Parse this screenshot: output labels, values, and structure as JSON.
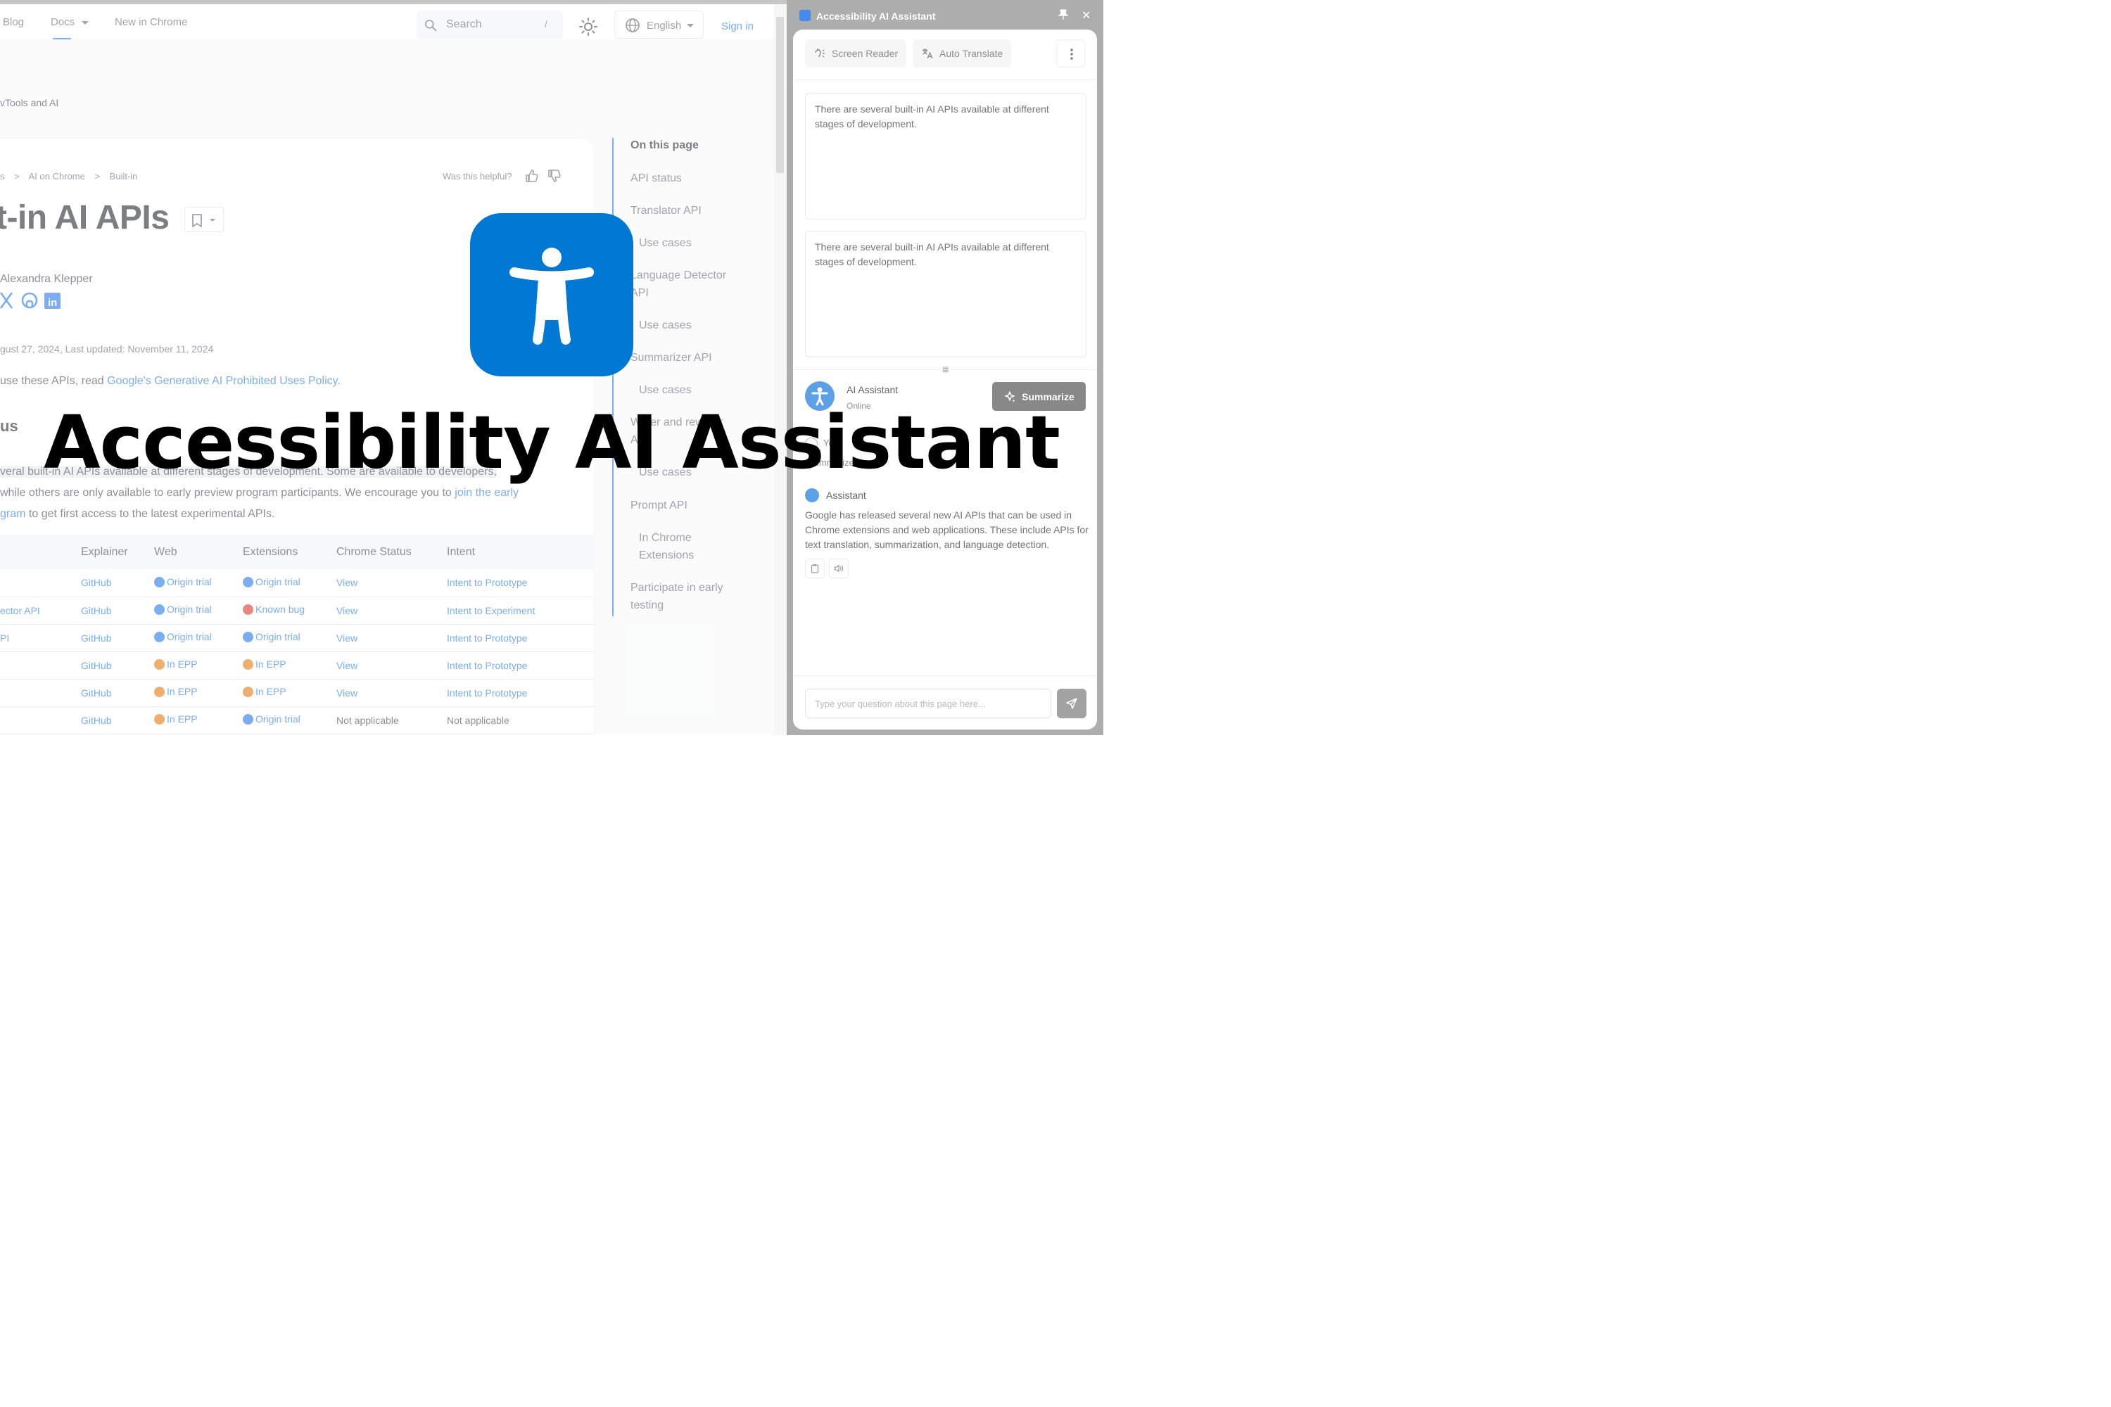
{
  "nav": {
    "items": [
      "Blog",
      "Docs",
      "New in Chrome"
    ],
    "search_placeholder": "Search",
    "search_shortcut": "/",
    "language": "English",
    "sign_in": "Sign in"
  },
  "subheader": {
    "text": "vTools and AI"
  },
  "breadcrumb": {
    "items": [
      "s",
      ">",
      "AI on Chrome",
      ">",
      "Built-in"
    ]
  },
  "feedback": {
    "label": "Was this helpful?"
  },
  "article": {
    "title": "t-in AI APIs",
    "author": "Alexandra Klepper",
    "dates": "gust 27, 2024, Last updated: November 11, 2024",
    "policy_prefix": "use these APIs, read ",
    "policy_link": "Google's Generative AI Prohibited Uses Policy",
    "policy_suffix": ".",
    "section_heading": "us",
    "para_line1": "veral built-in AI APIs available at different stages of development. Some are available to developers,",
    "para_line2_a": "while others are only available to early preview program participants. We encourage you to ",
    "para_line2_link": "join the early",
    "para_line3_link": "gram",
    "para_line3_b": " to get first access to the latest experimental APIs."
  },
  "table": {
    "headers": [
      "",
      "Explainer",
      "Web",
      "Extensions",
      "Chrome Status",
      "Intent"
    ],
    "rows": [
      {
        "api": "",
        "explainer": "GitHub",
        "web": "Origin trial",
        "web_icon": "blue",
        "ext": "Origin trial",
        "ext_icon": "blue",
        "status": "View",
        "intent": "Intent to Prototype"
      },
      {
        "api": "ector API",
        "explainer": "GitHub",
        "web": "Origin trial",
        "web_icon": "blue",
        "ext": "Known bug",
        "ext_icon": "red",
        "status": "View",
        "intent": "Intent to Experiment"
      },
      {
        "api": "PI",
        "explainer": "GitHub",
        "web": "Origin trial",
        "web_icon": "blue",
        "ext": "Origin trial",
        "ext_icon": "blue",
        "status": "View",
        "intent": "Intent to Prototype"
      },
      {
        "api": "",
        "explainer": "GitHub",
        "web": "In EPP",
        "web_icon": "orange",
        "ext": "In EPP",
        "ext_icon": "orange",
        "status": "View",
        "intent": "Intent to Prototype"
      },
      {
        "api": "",
        "explainer": "GitHub",
        "web": "In EPP",
        "web_icon": "orange",
        "ext": "In EPP",
        "ext_icon": "orange",
        "status": "View",
        "intent": "Intent to Prototype"
      },
      {
        "api": "",
        "explainer": "GitHub",
        "web": "In EPP",
        "web_icon": "orange",
        "ext": "Origin trial",
        "ext_icon": "blue",
        "status": "Not applicable",
        "intent": "Not applicable"
      }
    ]
  },
  "toc": {
    "heading": "On this page",
    "items": [
      "API status",
      "Translator API",
      "Use cases",
      "Language Detector",
      "API",
      "Use cases",
      "Summarizer API",
      "Use cases",
      "Writer and rewriter",
      "API",
      "Use cases",
      "Prompt API",
      "In Chrome",
      "Extensions",
      "Participate in early",
      "testing"
    ]
  },
  "panel": {
    "title": "Accessibility AI Assistant",
    "close": "✕",
    "toolbar": {
      "screen_reader": "Screen Reader",
      "auto_translate": "Auto Translate"
    },
    "box1": "There are several built-in AI APIs available at different stages of development.",
    "box2": "There are several built-in AI APIs available at different stages of development.",
    "bot_name": "AI Assistant",
    "bot_status": "Online",
    "summarize": "Summarize",
    "you_label": "You",
    "you_text": "Summarize",
    "assistant_label": "Assistant",
    "assistant_msg": "Google has released several new AI APIs that can be used in Chrome extensions and web applications. These include APIs for text translation, summarization, and language detection.",
    "input_placeholder": "Type your question about this page here..."
  },
  "promo": {
    "title": "Accessibility AI Assistant",
    "icon": "accessibility-person-icon",
    "icon_color": "#0078d4"
  },
  "colors": {
    "accent": "#1a73e8",
    "origin_trial": "#1a73e8",
    "known_bug": "#d93025",
    "in_epp": "#e37400"
  }
}
